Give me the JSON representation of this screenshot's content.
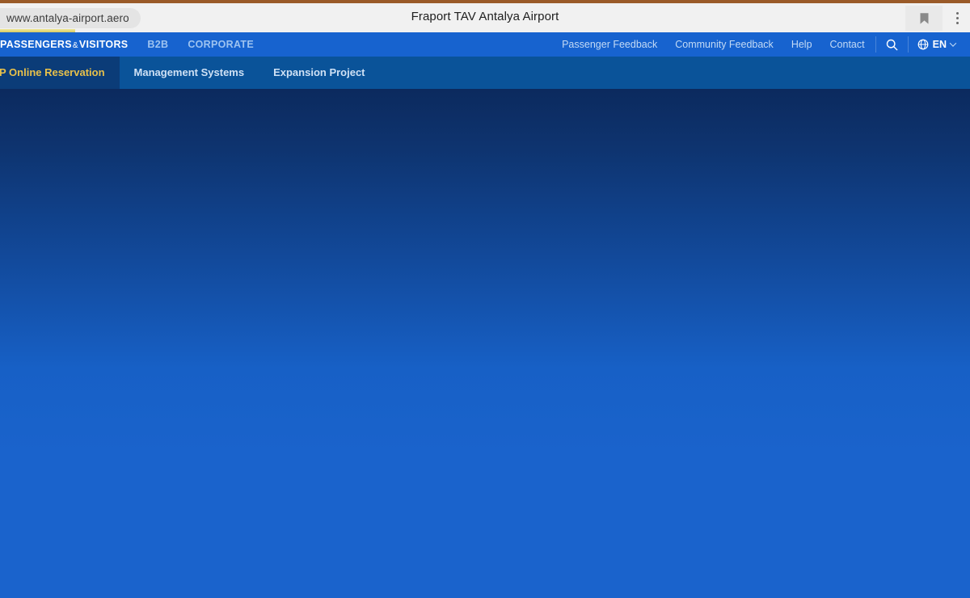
{
  "browser": {
    "url": "www.antalya-airport.aero",
    "page_title": "Fraport TAV Antalya Airport",
    "bookmark_icon": "bookmark-icon",
    "menu_icon": "three-dots-vertical-icon"
  },
  "primary_nav": {
    "items": [
      {
        "label_main": "PASSENGERS",
        "label_amp": "&",
        "label_rest": "VISITORS",
        "active": true
      },
      {
        "label": "B2B",
        "active": false
      },
      {
        "label": "CORPORATE",
        "active": false
      }
    ],
    "right_links": [
      {
        "label": "Passenger Feedback"
      },
      {
        "label": "Community Feedback"
      },
      {
        "label": "Help"
      },
      {
        "label": "Contact"
      }
    ],
    "search_icon": "search-icon",
    "language": {
      "globe_icon": "globe-icon",
      "code": "EN",
      "chevron_icon": "chevron-down-icon"
    }
  },
  "secondary_nav": {
    "items": [
      {
        "label": "CIP Online Reservation",
        "highlight": true
      },
      {
        "label": "Management Systems",
        "highlight": false
      },
      {
        "label": "Expansion Project",
        "highlight": false
      }
    ]
  },
  "colors": {
    "primary_nav_blue": "#1763cf",
    "secondary_nav_blue": "#0a5399",
    "highlight_box": "#0b3c78",
    "highlight_text": "#e8c14a",
    "hero_top": "#0c2a5e",
    "hero_bottom": "#1a63cc",
    "active_underline": "#e0d470",
    "tab_strip_accent": "#9a5a28"
  }
}
